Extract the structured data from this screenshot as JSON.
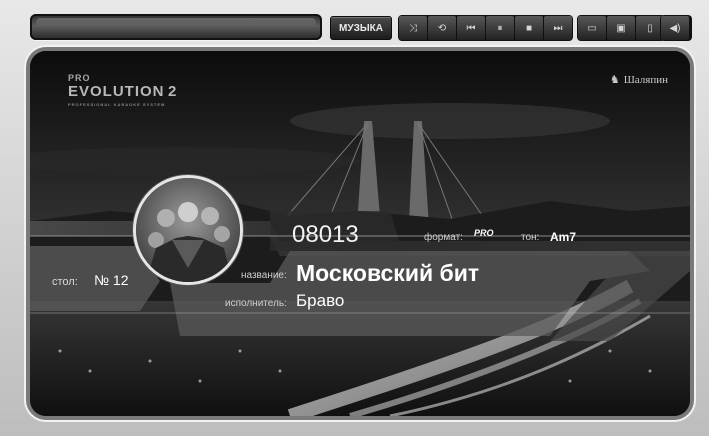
{
  "toolbar": {
    "music_label": "МУЗЫКА",
    "buttons": [
      "shuffle-icon",
      "repeat-icon",
      "previous-icon",
      "pause-icon",
      "stop-icon",
      "next-icon",
      "folder-icon",
      "save-icon",
      "trash-icon",
      "volume-icon"
    ]
  },
  "screen": {
    "logo_line1": "PRO",
    "logo_line2": "EVOLUTION",
    "logo_num": "2",
    "logo_sub": "PROFESSIONAL KARAOKE SYSTEM",
    "brand": "Шаляпин"
  },
  "song": {
    "code": "08013",
    "format_label": "формат:",
    "format_value": "PRO",
    "tone_label": "тон:",
    "tone_value": "Am7",
    "title_label": "название:",
    "title": "Московский бит",
    "artist_label": "исполнитель:",
    "artist": "Браво"
  },
  "table": {
    "label": "стол:",
    "number": "№ 12"
  },
  "colors": {
    "frame": "#cfcfcf",
    "screen_bg": "#050505",
    "text": "#ffffff"
  }
}
